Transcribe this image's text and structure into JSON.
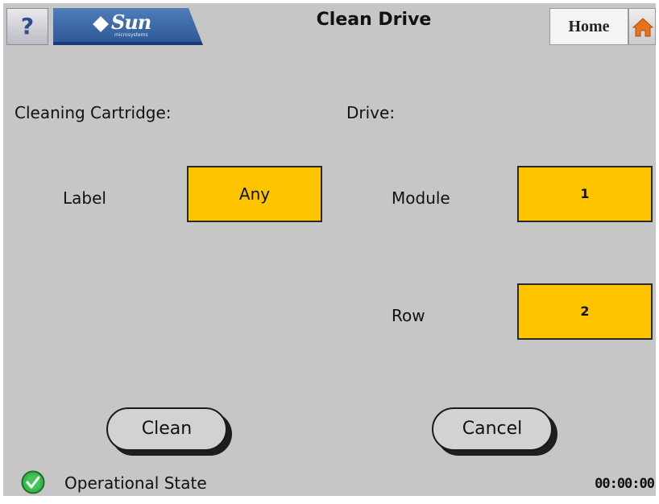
{
  "header": {
    "help_label": "?",
    "logo_text": "Sun",
    "logo_subtext": "microsystems",
    "title": "Clean Drive",
    "home_label": "Home",
    "home_icon": "house-icon"
  },
  "cartridge_section": {
    "heading": "Cleaning Cartridge:",
    "label_field": {
      "label": "Label",
      "value": "Any"
    }
  },
  "drive_section": {
    "heading": "Drive:",
    "module_field": {
      "label": "Module",
      "value": "1"
    },
    "row_field": {
      "label": "Row",
      "value": "2"
    }
  },
  "actions": {
    "clean_label": "Clean",
    "cancel_label": "Cancel"
  },
  "status": {
    "state_text": "Operational State",
    "state_icon": "check-circle-icon",
    "clock": "00:00:00"
  },
  "colors": {
    "background": "#c6c6c6",
    "value_box": "#ffc400",
    "header_logo": "#3a68a8",
    "status_ok": "#39b54a",
    "home_icon": "#e8711e"
  }
}
